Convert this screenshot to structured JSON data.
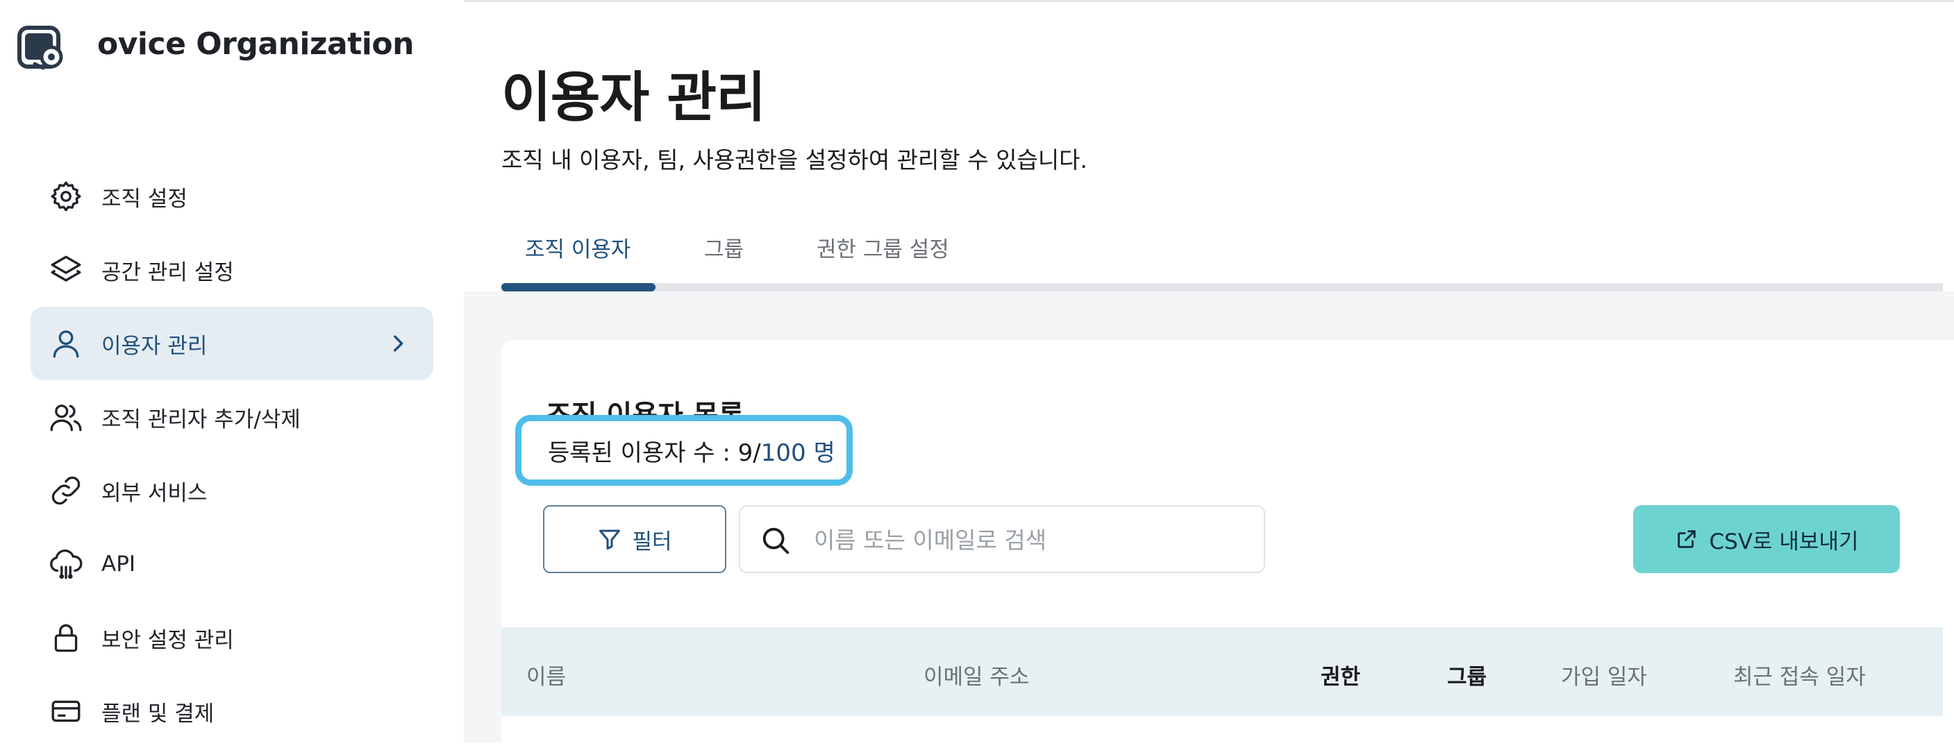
{
  "sidebar": {
    "org_name": "ovice Organization",
    "items": [
      {
        "label": "조직 설정",
        "icon": "gear-icon"
      },
      {
        "label": "공간 관리 설정",
        "icon": "layers-icon"
      },
      {
        "label": "이용자 관리",
        "icon": "user-icon",
        "active": true
      },
      {
        "label": "조직 관리자 추가/삭제",
        "icon": "users-icon"
      },
      {
        "label": "외부 서비스",
        "icon": "link-icon"
      },
      {
        "label": "API",
        "icon": "cloud-icon"
      },
      {
        "label": "보안 설정 관리",
        "icon": "lock-icon"
      },
      {
        "label": "플랜 및 결제",
        "icon": "credit-card-icon"
      }
    ]
  },
  "header": {
    "title": "이용자 관리",
    "subtitle": "조직 내 이용자, 팀, 사용권한을 설정하여 관리할 수 있습니다."
  },
  "tabs": [
    {
      "label": "조직 이용자",
      "active": true
    },
    {
      "label": "그룹"
    },
    {
      "label": "권한 그룹 설정"
    }
  ],
  "card": {
    "title": "조직 이용자 목록",
    "count_label": "등록된 이용자 수 : 9/",
    "count_limit": "100 명",
    "filter_label": "필터",
    "search_placeholder": "이름 또는 이메일로 검색",
    "csv_label": "CSV로 내보내기"
  },
  "table": {
    "columns": [
      "이름",
      "이메일 주소",
      "권한",
      "그룹",
      "가입 일자",
      "최근 접속 일자"
    ]
  },
  "colors": {
    "accent": "#1f4f7d",
    "active_nav_bg": "#e6edf2",
    "highlight_border": "#4fbde9",
    "csv_button": "#6dd3d1",
    "table_header_bg": "#e7f0f2"
  }
}
